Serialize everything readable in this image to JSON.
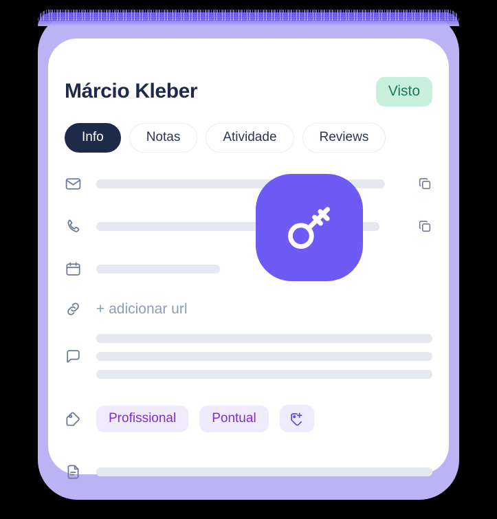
{
  "card": {
    "person_name": "Márcio Kleber",
    "status_badge": "Visto",
    "tabs": [
      {
        "label": "Info",
        "active": true
      },
      {
        "label": "Notas",
        "active": false
      },
      {
        "label": "Atividade",
        "active": false
      },
      {
        "label": "Reviews",
        "active": false
      }
    ],
    "rows": {
      "email": {
        "icon": "envelope-icon",
        "value": "",
        "action_icon": "copy-icon"
      },
      "phone": {
        "icon": "phone-icon",
        "value": "",
        "action_icon": "copy-icon"
      },
      "date": {
        "icon": "calendar-icon",
        "value": ""
      },
      "url": {
        "icon": "link-icon",
        "add_label": "+ adicionar url"
      },
      "notes": {
        "icon": "chat-bubble-icon",
        "line_count": 3
      },
      "tags": {
        "icon": "tag-icon",
        "chips": [
          "Profissional",
          "Pontual"
        ],
        "add_icon": "tag-plus-icon"
      },
      "document": {
        "icon": "document-icon",
        "value": ""
      }
    },
    "overlay_badge": {
      "icon": "key-icon"
    }
  },
  "colors": {
    "accent_purple": "#6C5CF5",
    "frame_purple": "#BCB3F5",
    "navy": "#1E2A4A",
    "badge_green_bg": "#C8F0DC",
    "badge_green_text": "#1D7A54",
    "chip_bg": "#F0EBFC",
    "chip_text": "#7B2FD6",
    "skeleton": "#E5E9EF",
    "muted_text": "#8D9CB8",
    "icon_gray": "#6B7A99",
    "page_bg": "#000000"
  }
}
